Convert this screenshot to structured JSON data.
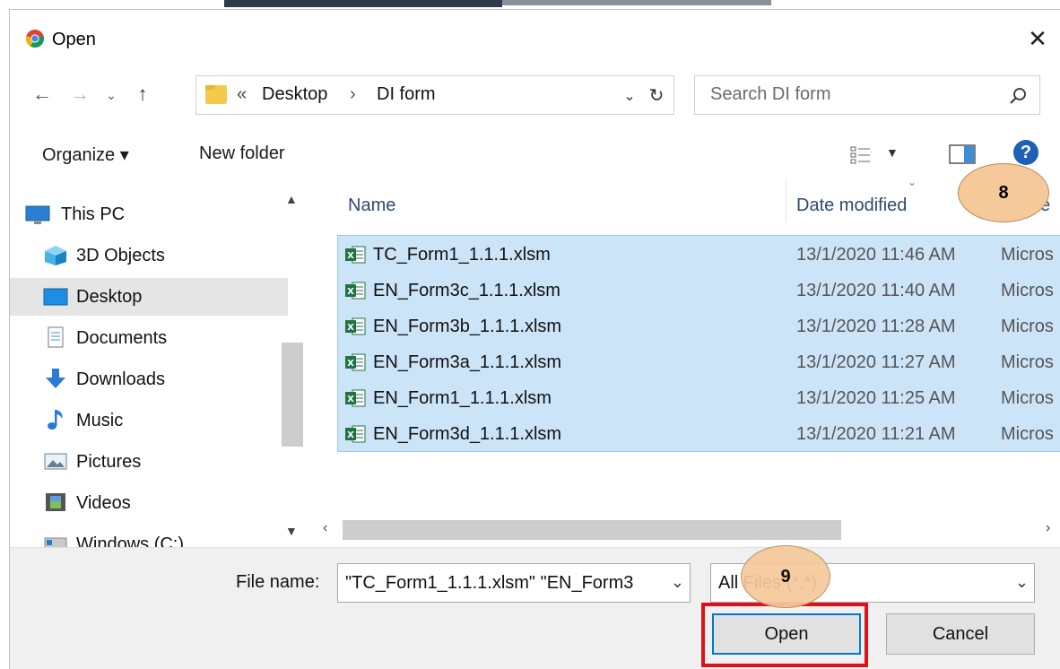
{
  "window": {
    "title": "Open"
  },
  "address": {
    "prefix": "«",
    "crumb1": "Desktop",
    "sep": "›",
    "crumb2": "DI form"
  },
  "search": {
    "placeholder": "Search DI form"
  },
  "toolbar": {
    "organize": "Organize ▾",
    "new_folder": "New folder"
  },
  "nav": {
    "items": [
      {
        "label": "This PC",
        "icon": "computer-icon"
      },
      {
        "label": "3D Objects",
        "icon": "cube-icon"
      },
      {
        "label": "Desktop",
        "icon": "desktop-icon",
        "selected": true
      },
      {
        "label": "Documents",
        "icon": "documents-icon"
      },
      {
        "label": "Downloads",
        "icon": "download-arrow-icon"
      },
      {
        "label": "Music",
        "icon": "music-note-icon"
      },
      {
        "label": "Pictures",
        "icon": "pictures-icon"
      },
      {
        "label": "Videos",
        "icon": "film-icon"
      },
      {
        "label": "Windows (C:)",
        "icon": "drive-icon"
      }
    ]
  },
  "columns": {
    "name": "Name",
    "date": "Date modified",
    "type_partial": "e"
  },
  "files": [
    {
      "name": "TC_Form1_1.1.1.xlsm",
      "date": "13/1/2020 11:46 AM",
      "type": "Micros"
    },
    {
      "name": "EN_Form3c_1.1.1.xlsm",
      "date": "13/1/2020 11:40 AM",
      "type": "Micros"
    },
    {
      "name": "EN_Form3b_1.1.1.xlsm",
      "date": "13/1/2020 11:28 AM",
      "type": "Micros"
    },
    {
      "name": "EN_Form3a_1.1.1.xlsm",
      "date": "13/1/2020 11:27 AM",
      "type": "Micros"
    },
    {
      "name": "EN_Form1_1.1.1.xlsm",
      "date": "13/1/2020 11:25 AM",
      "type": "Micros"
    },
    {
      "name": "EN_Form3d_1.1.1.xlsm",
      "date": "13/1/2020 11:21 AM",
      "type": "Micros"
    }
  ],
  "bottom": {
    "file_name_label": "File name:",
    "file_name_value": "\"TC_Form1_1.1.1.xlsm\" \"EN_Form3",
    "filter_value": "All Files (*.*)",
    "open_label": "Open",
    "cancel_label": "Cancel"
  },
  "callouts": {
    "c8": "8",
    "c9": "9"
  },
  "colors": {
    "selection": "#cce4f7",
    "accent": "#0078d7",
    "highlight_box": "#e0101a",
    "callout_fill": "#f6c99b"
  }
}
